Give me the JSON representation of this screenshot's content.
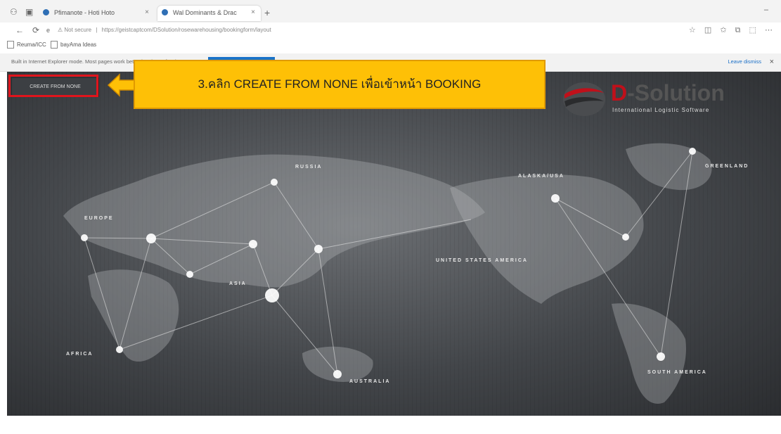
{
  "browser": {
    "tabs": [
      {
        "label": "Pfimanote - Hoti Hoto",
        "active": false
      },
      {
        "label": "Wal Dominants & Drac",
        "active": true
      }
    ],
    "address": {
      "security": "Not secure",
      "url": "https://geistcaptcom/DSolution/rosewarehousing/bookingform/layout"
    },
    "bookmarks": [
      "Reuma/ICC",
      "bayAma Ideas"
    ],
    "infobar": {
      "message": "Built in Internet Explorer mode. Most pages work better in Microsoft Edge.",
      "dismiss": "Leave dismiss"
    }
  },
  "app": {
    "create_button_label": "CREATE FROM NONE",
    "callout": "3.คลิก CREATE FROM NONE เพื่อเข้าหน้า BOOKING",
    "logo": {
      "brand_prefix": "D",
      "brand_rest": "-Solution",
      "tagline": "International Logistic Software"
    },
    "map_labels": {
      "russia": "RUSSIA",
      "alaska": "ALASKA/USA",
      "greenland": "GREENLAND",
      "europe": "EUROPE",
      "usa": "UNITED STATES AMERICA",
      "asia": "ASIA",
      "africa": "AFRICA",
      "australia": "AUSTRALIA",
      "south_america": "SOUTH AMERICA"
    }
  },
  "colors": {
    "accent": "#fec006",
    "highlight": "#e0141c",
    "brand_red": "#c0101a"
  }
}
